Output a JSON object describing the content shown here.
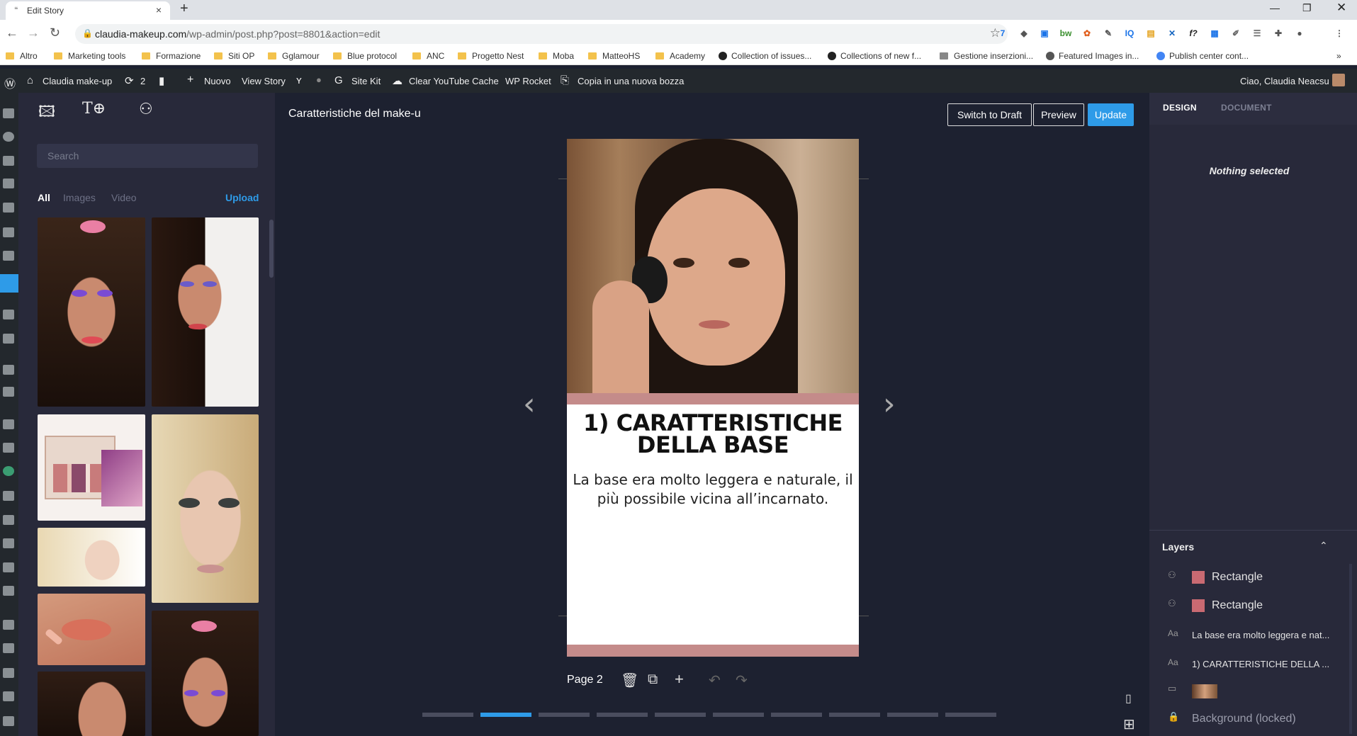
{
  "browser": {
    "tab_title": "Edit Story",
    "url_host": "claudia-makeup.com",
    "url_path": "/wp-admin/post.php?post=8801&action=edit",
    "extensions": [
      "7",
      "bw",
      "IQ",
      "f?"
    ]
  },
  "bookmarks": [
    "Altro",
    "Marketing tools",
    "Formazione",
    "Siti OP",
    "Gglamour",
    "Blue protocol",
    "ANC",
    "Progetto Nest",
    "Moba",
    "MatteoHS",
    "Academy",
    "Collection of issues...",
    "Collections of new f...",
    "Gestione inserzioni...",
    "Featured Images in...",
    "Publish center cont..."
  ],
  "adminbar": {
    "site": "Claudia make-up",
    "updates": "2",
    "new": "Nuovo",
    "view": "View Story",
    "sitekit": "Site Kit",
    "yt_cache": "Clear YouTube Cache",
    "rocket": "WP Rocket",
    "copy": "Copia in una nuova bozza",
    "greeting": "Ciao, Claudia Neacsu"
  },
  "library": {
    "search_placeholder": "Search",
    "filters": {
      "all": "All",
      "images": "Images",
      "video": "Video",
      "upload": "Upload"
    }
  },
  "editor": {
    "story_title": "Caratteristiche del make-u",
    "switch_draft": "Switch to Draft",
    "preview": "Preview",
    "update": "Update",
    "page_label": "Page 2",
    "headline": "1) CARATTERISTICHE DELLA BASE",
    "body": "La base era molto leggera e naturale, il più possibile vicina all’incarnato.",
    "active_page": 2,
    "page_count": 10
  },
  "rightpanel": {
    "design_tab": "DESIGN",
    "document_tab": "DOCUMENT",
    "nothing_selected": "Nothing selected",
    "layers_title": "Layers",
    "layers": [
      {
        "name": "Rectangle",
        "type": "shape"
      },
      {
        "name": "Rectangle",
        "type": "shape"
      },
      {
        "name": "La base era molto leggera e nat...",
        "type": "text"
      },
      {
        "name": "1) CARATTERISTICHE DELLA ...",
        "type": "text"
      },
      {
        "name": "",
        "type": "image"
      },
      {
        "name": "Background (locked)",
        "type": "background"
      }
    ]
  },
  "colors": {
    "accent": "#2e9be8",
    "band": "#c48b8a",
    "panel": "#28293a",
    "canvas_bg": "#1d2130"
  }
}
